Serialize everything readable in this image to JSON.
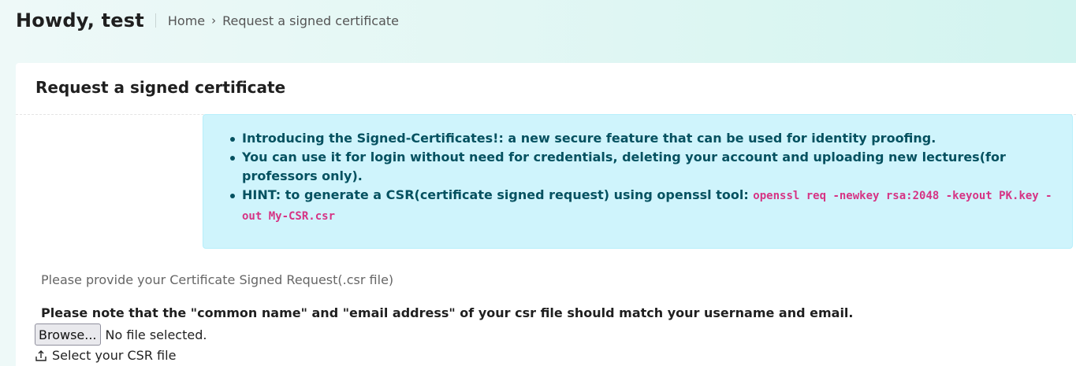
{
  "header": {
    "greeting": "Howdy, test",
    "breadcrumb": {
      "home": "Home",
      "separator": "›",
      "current": "Request a signed certificate"
    }
  },
  "card": {
    "title": "Request a signed certificate",
    "alert": {
      "items": [
        "Introducing the Signed-Certificates!: a new secure feature that can be used for identity proofing.",
        "You can use it for login without need for credentials, deleting your account and uploading new lectures(for professors only).",
        "HINT: to generate a CSR(certificate signed request) using openssl tool: "
      ],
      "command": "openssl req -newkey rsa:2048 -keyout PK.key -out My-CSR.csr"
    },
    "form": {
      "provide_label": "Please provide your Certificate Signed Request(.csr file)",
      "note": "Please note that the \"common name\" and \"email address\" of your csr file should match your username and email.",
      "browse_label": "Browse...",
      "file_status": "No file selected.",
      "select_label": "Select your CSR file"
    }
  },
  "colors": {
    "alert_background": "#cff4fc",
    "alert_text": "#055160",
    "code_text": "#d63384"
  },
  "icons": {
    "upload": "upload-icon"
  }
}
